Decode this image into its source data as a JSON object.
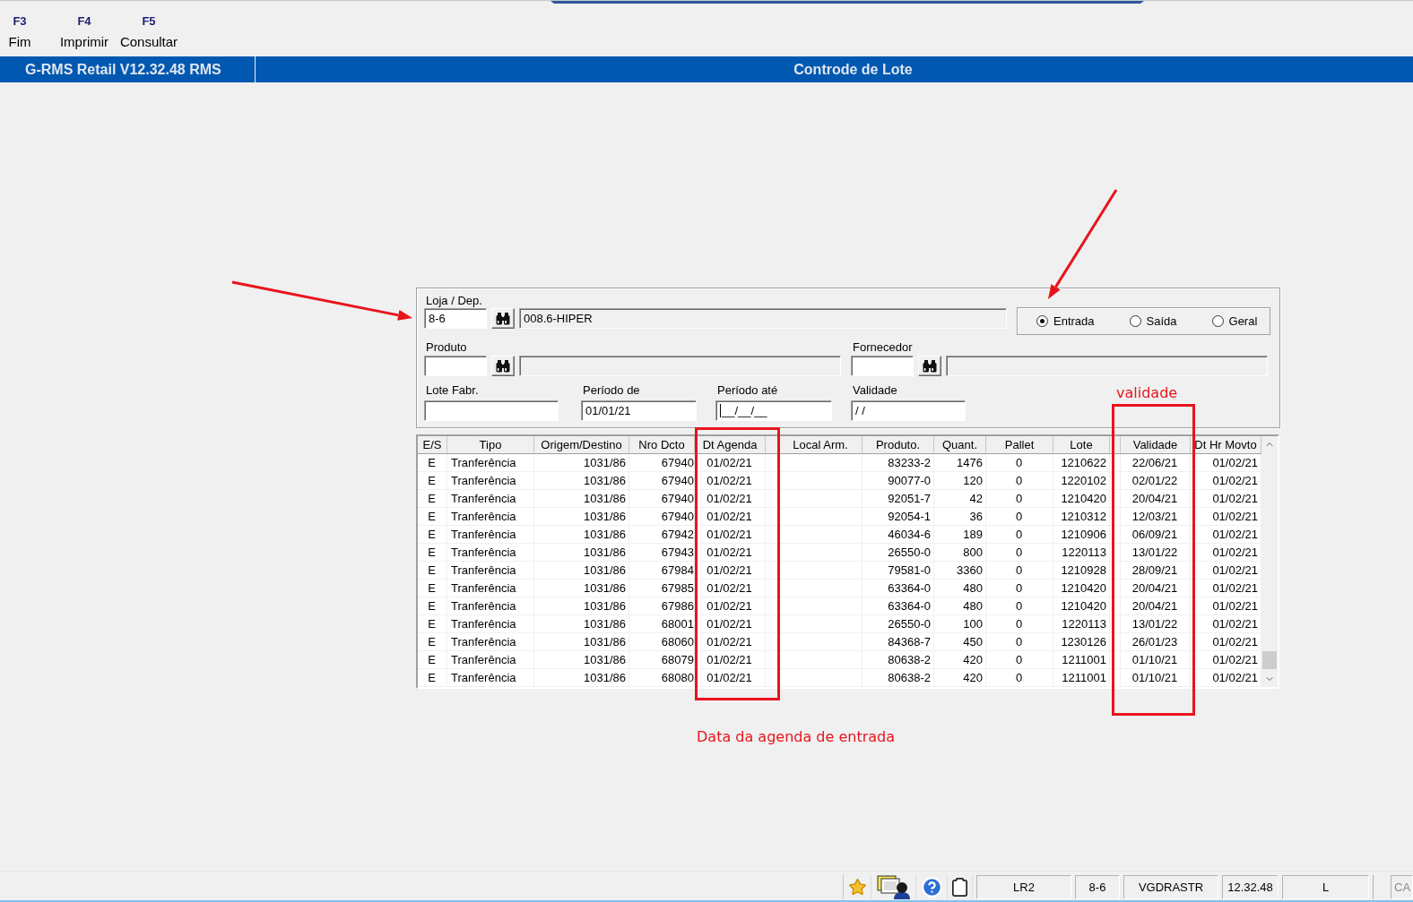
{
  "toolbar": [
    {
      "key": "F3",
      "label": "Fim"
    },
    {
      "key": "F4",
      "label": "Imprimir"
    },
    {
      "key": "F5",
      "label": "Consultar"
    }
  ],
  "title_bar": {
    "app_title": "G-RMS Retail V12.32.48 RMS",
    "screen_title": "Controde de Lote"
  },
  "form": {
    "loja_dep": {
      "label": "Loja / Dep.",
      "value": "8-6",
      "description": "008.6-HIPER",
      "focused": false
    },
    "movement": [
      {
        "label": "Entrada",
        "selected": true
      },
      {
        "label": "Saída",
        "selected": false
      },
      {
        "label": "Geral",
        "selected": false
      }
    ],
    "produto": {
      "label": "Produto",
      "focused": false
    },
    "fornecedor": {
      "label": "Fornecedor",
      "focused": false
    },
    "lote_fabr": {
      "label": "Lote Fabr.",
      "focused": false
    },
    "periodo_de": {
      "label": "Período de",
      "value": "01/01/21",
      "focused": false
    },
    "periodo_ate": {
      "label": "Período até",
      "value": "__/__/__",
      "focused": true
    },
    "validade": {
      "label": "Validade",
      "value": "/ /",
      "focused": false
    }
  },
  "table": {
    "columns": [
      "E/S",
      "Tipo",
      "Origem/Destino",
      "Nro Dcto",
      "Dt Agenda",
      "Local Arm.",
      "Produto.",
      "Quant.",
      "Pallet",
      "Lote",
      "Validade",
      "Dt Hr Movto"
    ],
    "rows": [
      {
        "e_s": "E",
        "tipo": "Tranferência",
        "origem_destino": "1031/86",
        "nro_dcto": "67940",
        "dt_agenda": "01/02/21",
        "produto": "83233-2",
        "quant": "1476",
        "pallet": "0",
        "lote": "1210622",
        "validade": "22/06/21",
        "dt_hr_movto": "01/02/21"
      },
      {
        "e_s": "E",
        "tipo": "Tranferência",
        "origem_destino": "1031/86",
        "nro_dcto": "67940",
        "dt_agenda": "01/02/21",
        "produto": "90077-0",
        "quant": "120",
        "pallet": "0",
        "lote": "1220102",
        "validade": "02/01/22",
        "dt_hr_movto": "01/02/21"
      },
      {
        "e_s": "E",
        "tipo": "Tranferência",
        "origem_destino": "1031/86",
        "nro_dcto": "67940",
        "dt_agenda": "01/02/21",
        "produto": "92051-7",
        "quant": "42",
        "pallet": "0",
        "lote": "1210420",
        "validade": "20/04/21",
        "dt_hr_movto": "01/02/21"
      },
      {
        "e_s": "E",
        "tipo": "Tranferência",
        "origem_destino": "1031/86",
        "nro_dcto": "67940",
        "dt_agenda": "01/02/21",
        "produto": "92054-1",
        "quant": "36",
        "pallet": "0",
        "lote": "1210312",
        "validade": "12/03/21",
        "dt_hr_movto": "01/02/21"
      },
      {
        "e_s": "E",
        "tipo": "Tranferência",
        "origem_destino": "1031/86",
        "nro_dcto": "67942",
        "dt_agenda": "01/02/21",
        "produto": "46034-6",
        "quant": "189",
        "pallet": "0",
        "lote": "1210906",
        "validade": "06/09/21",
        "dt_hr_movto": "01/02/21"
      },
      {
        "e_s": "E",
        "tipo": "Tranferência",
        "origem_destino": "1031/86",
        "nro_dcto": "67943",
        "dt_agenda": "01/02/21",
        "produto": "26550-0",
        "quant": "800",
        "pallet": "0",
        "lote": "1220113",
        "validade": "13/01/22",
        "dt_hr_movto": "01/02/21"
      },
      {
        "e_s": "E",
        "tipo": "Tranferência",
        "origem_destino": "1031/86",
        "nro_dcto": "67984",
        "dt_agenda": "01/02/21",
        "produto": "79581-0",
        "quant": "3360",
        "pallet": "0",
        "lote": "1210928",
        "validade": "28/09/21",
        "dt_hr_movto": "01/02/21"
      },
      {
        "e_s": "E",
        "tipo": "Tranferência",
        "origem_destino": "1031/86",
        "nro_dcto": "67985",
        "dt_agenda": "01/02/21",
        "produto": "63364-0",
        "quant": "480",
        "pallet": "0",
        "lote": "1210420",
        "validade": "20/04/21",
        "dt_hr_movto": "01/02/21"
      },
      {
        "e_s": "E",
        "tipo": "Tranferência",
        "origem_destino": "1031/86",
        "nro_dcto": "67986",
        "dt_agenda": "01/02/21",
        "produto": "63364-0",
        "quant": "480",
        "pallet": "0",
        "lote": "1210420",
        "validade": "20/04/21",
        "dt_hr_movto": "01/02/21"
      },
      {
        "e_s": "E",
        "tipo": "Tranferência",
        "origem_destino": "1031/86",
        "nro_dcto": "68001",
        "dt_agenda": "01/02/21",
        "produto": "26550-0",
        "quant": "100",
        "pallet": "0",
        "lote": "1220113",
        "validade": "13/01/22",
        "dt_hr_movto": "01/02/21"
      },
      {
        "e_s": "E",
        "tipo": "Tranferência",
        "origem_destino": "1031/86",
        "nro_dcto": "68060",
        "dt_agenda": "01/02/21",
        "produto": "84368-7",
        "quant": "450",
        "pallet": "0",
        "lote": "1230126",
        "validade": "26/01/23",
        "dt_hr_movto": "01/02/21"
      },
      {
        "e_s": "E",
        "tipo": "Tranferência",
        "origem_destino": "1031/86",
        "nro_dcto": "68079",
        "dt_agenda": "01/02/21",
        "produto": "80638-2",
        "quant": "420",
        "pallet": "0",
        "lote": "1211001",
        "validade": "01/10/21",
        "dt_hr_movto": "01/02/21"
      },
      {
        "e_s": "E",
        "tipo": "Tranferência",
        "origem_destino": "1031/86",
        "nro_dcto": "68080",
        "dt_agenda": "01/02/21",
        "produto": "80638-2",
        "quant": "420",
        "pallet": "0",
        "lote": "1211001",
        "validade": "01/10/21",
        "dt_hr_movto": "01/02/21"
      }
    ]
  },
  "status_bar": {
    "panels": [
      {
        "text": "LR2",
        "disabled": false
      },
      {
        "text": "8-6",
        "disabled": false
      },
      {
        "text": "VGDRASTR",
        "disabled": false
      },
      {
        "text": "12.32.48",
        "disabled": false
      },
      {
        "text": "L",
        "disabled": false
      },
      {
        "text": "CA",
        "disabled": true
      }
    ]
  },
  "annotations": [
    "validade",
    "Data da agenda de entrada"
  ]
}
